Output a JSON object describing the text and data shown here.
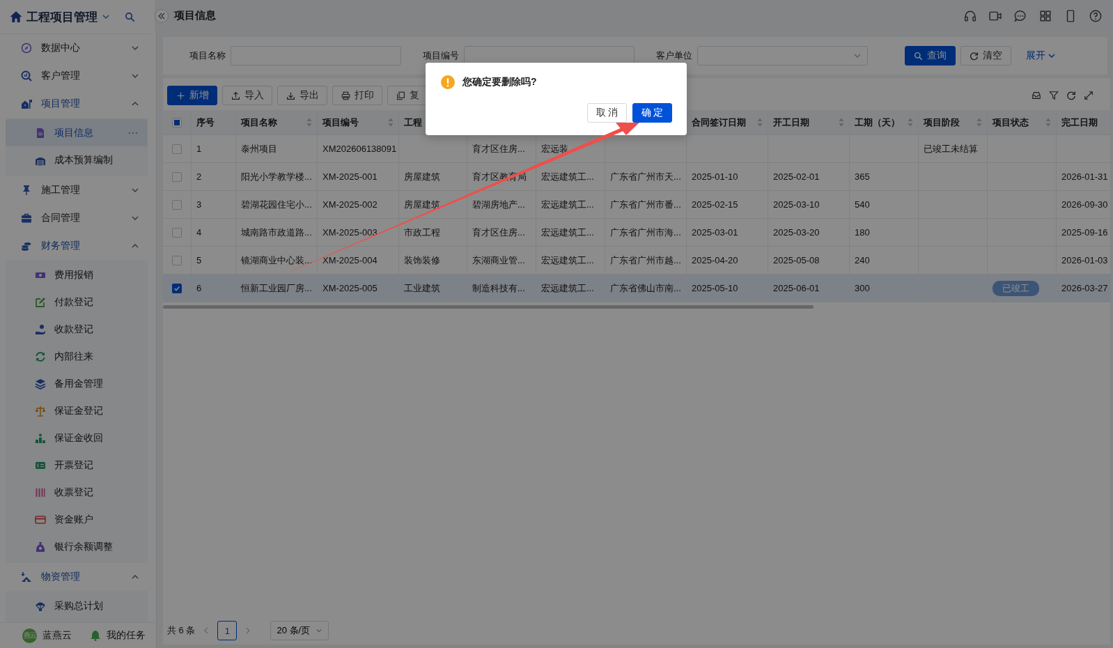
{
  "sidebar": {
    "title": "工程项目管理",
    "items": [
      {
        "label": "数据中心",
        "expanded": false
      },
      {
        "label": "客户管理",
        "expanded": false
      },
      {
        "label": "项目管理",
        "expanded": true,
        "children": [
          {
            "label": "项目信息",
            "selected": true
          },
          {
            "label": "成本预算编制",
            "selected": false
          }
        ]
      },
      {
        "label": "施工管理",
        "expanded": false
      },
      {
        "label": "合同管理",
        "expanded": false
      },
      {
        "label": "财务管理",
        "expanded": true,
        "children": [
          {
            "label": "费用报销",
            "selected": false
          },
          {
            "label": "付款登记",
            "selected": false
          },
          {
            "label": "收款登记",
            "selected": false
          },
          {
            "label": "内部往来",
            "selected": false
          },
          {
            "label": "备用金管理",
            "selected": false
          },
          {
            "label": "保证金登记",
            "selected": false
          },
          {
            "label": "保证金收回",
            "selected": false
          },
          {
            "label": "开票登记",
            "selected": false
          },
          {
            "label": "收票登记",
            "selected": false
          },
          {
            "label": "资金账户",
            "selected": false
          },
          {
            "label": "银行余额调整",
            "selected": false
          }
        ]
      },
      {
        "label": "物资管理",
        "expanded": true,
        "children": [
          {
            "label": "采购总计划",
            "selected": false
          }
        ]
      }
    ],
    "footer": {
      "avatar_text": "燕云",
      "user": "蓝燕云",
      "tasks": "我的任务"
    }
  },
  "page": {
    "title": "项目信息"
  },
  "search": {
    "fields": [
      {
        "label": "项目名称",
        "kind": "text"
      },
      {
        "label": "项目编号",
        "kind": "text"
      },
      {
        "label": "客户单位",
        "kind": "select"
      }
    ],
    "query": "查询",
    "clear": "清空",
    "expand": "展开"
  },
  "toolbar": {
    "buttons": [
      {
        "label": "新增",
        "kind": "primary"
      },
      {
        "label": "导入",
        "kind": "default"
      },
      {
        "label": "导出",
        "kind": "default"
      },
      {
        "label": "打印",
        "kind": "default"
      },
      {
        "label": "复",
        "kind": "default"
      }
    ]
  },
  "table": {
    "header_checkbox": {
      "indeterminate": true
    },
    "columns": [
      {
        "label": "序号",
        "sortable": false
      },
      {
        "label": "项目名称",
        "sortable": true
      },
      {
        "label": "项目编号",
        "sortable": true
      },
      {
        "label": "工程"
      },
      null,
      null,
      null,
      {
        "label": "合同签订日期",
        "sortable": true
      },
      {
        "label": "开工日期",
        "sortable": true
      },
      {
        "label": "工期（天）",
        "sortable": true
      },
      {
        "label": "项目阶段",
        "sortable": true
      },
      {
        "label": "项目状态",
        "sortable": true
      },
      {
        "label": "完工日期",
        "sortable": false
      }
    ],
    "rows": [
      {
        "selected": false,
        "cells": [
          "1",
          "泰州项目",
          "XM202606138091",
          null,
          "育才区住房...",
          "宏远装",
          null,
          null,
          null,
          null,
          "已竣工未结算",
          null,
          null
        ]
      },
      {
        "selected": false,
        "cells": [
          "2",
          "阳光小学教学楼...",
          "XM-2025-001",
          "房屋建筑",
          "育才区教育局",
          "宏远建筑工...",
          "广东省广州市天...",
          "2025-01-10",
          "2025-02-01",
          "365",
          null,
          null,
          "2026-01-31"
        ]
      },
      {
        "selected": false,
        "cells": [
          "3",
          "碧湖花园住宅小...",
          "XM-2025-002",
          "房屋建筑",
          "碧湖房地产...",
          "宏远建筑工...",
          "广东省广州市番...",
          "2025-02-15",
          "2025-03-10",
          "540",
          null,
          null,
          "2026-09-30"
        ]
      },
      {
        "selected": false,
        "cells": [
          "4",
          "城南路市政道路...",
          "XM-2025-003",
          "市政工程",
          "育才区住房...",
          "宏远建筑工...",
          "广东省广州市海...",
          "2025-03-01",
          "2025-03-20",
          "180",
          null,
          null,
          "2025-09-16"
        ]
      },
      {
        "selected": false,
        "cells": [
          "5",
          "镜湖商业中心装...",
          "XM-2025-004",
          "装饰装修",
          "东湖商业管...",
          "宏远建筑工...",
          "广东省广州市越...",
          "2025-04-20",
          "2025-05-08",
          "240",
          null,
          null,
          "2026-01-03"
        ]
      },
      {
        "selected": true,
        "cells": [
          "6",
          "恒新工业园厂房...",
          "XM-2025-005",
          "工业建筑",
          "制造科技有...",
          "宏远建筑工...",
          "广东省佛山市南...",
          "2025-05-10",
          "2025-06-01",
          "300",
          null,
          "已竣工",
          "2026-03-27"
        ]
      }
    ]
  },
  "pagination": {
    "total": "共 6 条",
    "pages": [
      {
        "label": "1",
        "selected": true
      }
    ],
    "page_size": "20 条/页"
  },
  "dialog": {
    "message": "您确定要删除吗?",
    "buttons": [
      {
        "label": "取 消",
        "kind": "default"
      },
      {
        "label": "确 定",
        "kind": "primary"
      }
    ]
  },
  "annotations": [
    {
      "kind": "arrow"
    }
  ]
}
